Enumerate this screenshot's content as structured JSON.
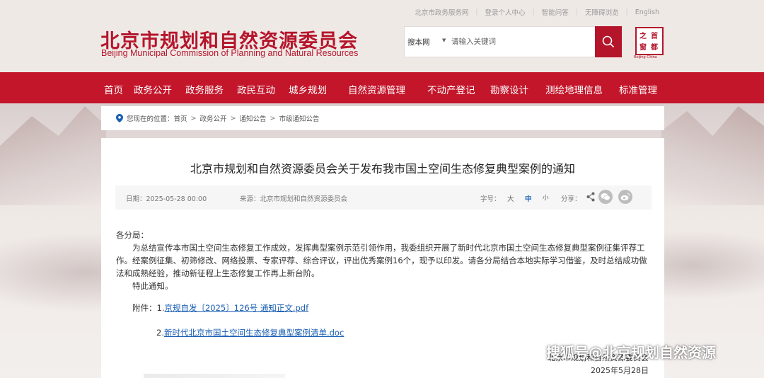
{
  "topbar": {
    "links": [
      "北京市政务服务网",
      "登录个人中心",
      "智能问答",
      "无障碍浏览",
      "English"
    ]
  },
  "header": {
    "title": "北京市规划和自然资源委员会",
    "subtitle": "Beijing Municipal Commission of Planning and Natural Resources",
    "search_scope": "搜本网",
    "search_placeholder": "请输入关键词",
    "seal_chars": [
      "首",
      "都",
      "之",
      "窗"
    ],
    "seal_caption": "Beijing·China"
  },
  "nav": {
    "items": [
      "首页",
      "政务公开",
      "政务服务",
      "政民互动",
      "城乡规划",
      "自然资源管理",
      "不动产登记",
      "勘察设计",
      "测绘地理信息",
      "标准管理"
    ]
  },
  "breadcrumb": {
    "prefix": "您现在的位置：",
    "items": [
      "首页",
      "政务公开",
      "通知公告",
      "市级通知公告"
    ]
  },
  "article": {
    "title": "北京市规划和自然资源委员会关于发布我市国土空间生态修复典型案例的通知",
    "date": "日期：2025-05-28 00:00",
    "source": "来源：北京市规划和自然资源委员会",
    "font_size_label": "字号：",
    "font_sizes": [
      "大",
      "中",
      "小"
    ],
    "share_label": "分享：",
    "salutation": "各分局：",
    "paragraph": "为总结宣传本市国土空间生态修复工作成效，发挥典型案例示范引领作用，我委组织开展了新时代北京市国土空间生态修复典型案例征集评荐工作。经案例征集、初筛修改、网络投票、专家评荐、综合评议，评出优秀案例16个，现予以印发。请各分局结合本地实际学习借鉴，及时总结成功做法和成熟经验，推动新征程上生态修复工作再上新台阶。",
    "closing": "特此通知。",
    "attach_label": "附件：",
    "attach_1_num": "1.",
    "attach_1": "京规自发〔2025〕126号 通知正文.pdf",
    "attach_2_num": "2.",
    "attach_2": "新时代北京市国土空间生态修复典型案例清单.doc",
    "signer": "北京市规划和自然资源委员会",
    "sign_date": "2025年5月28日"
  },
  "watermark": "搜狐号@北京规划自然资源",
  "colors": {
    "brand": "#c3162b",
    "link": "#1a5fb4"
  }
}
